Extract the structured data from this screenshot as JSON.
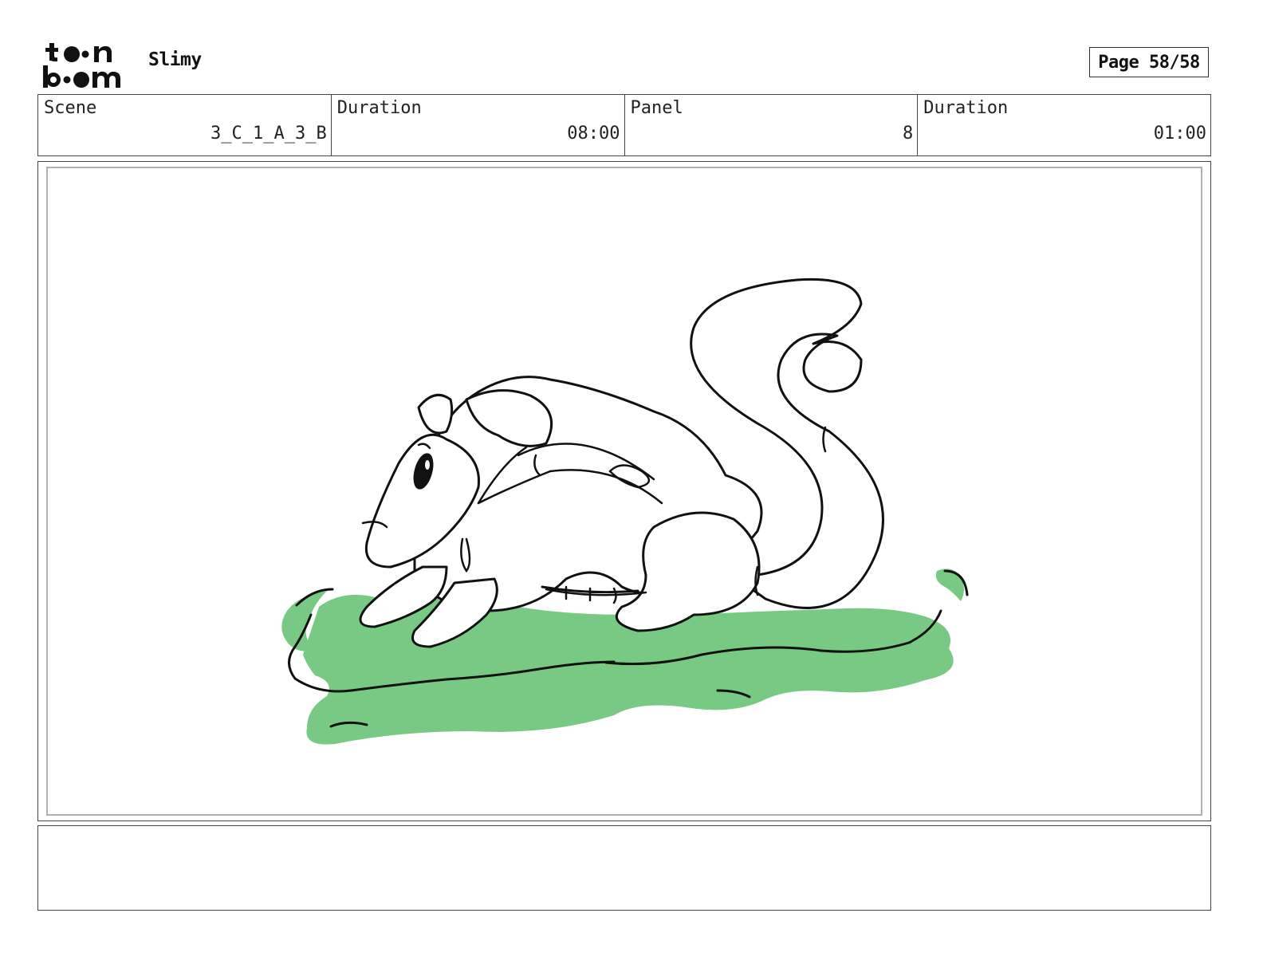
{
  "header": {
    "logo_text": "toon boom",
    "project_title": "Slimy",
    "page_label": "Page 58/58"
  },
  "info": {
    "scene_label": "Scene",
    "scene_value": "3_C_1_A_3_B",
    "scene_duration_label": "Duration",
    "scene_duration_value": "08:00",
    "panel_label": "Panel",
    "panel_value": "8",
    "panel_duration_label": "Duration",
    "panel_duration_value": "01:00"
  },
  "panel_image": {
    "subject": "slime-creature-sketch",
    "slime_color": "#77c983",
    "line_color": "#111111"
  },
  "notes": {
    "text": ""
  }
}
